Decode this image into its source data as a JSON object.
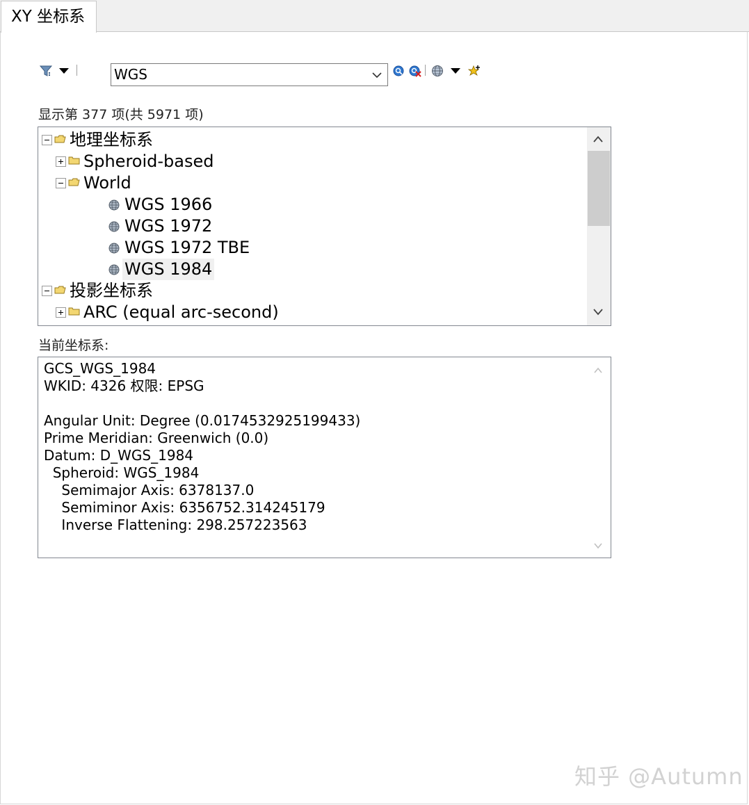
{
  "tab": {
    "label": "XY 坐标系"
  },
  "toolbar": {
    "filter_icon": "filter-icon",
    "search_value": "WGS",
    "icons": [
      "search-icon",
      "clear-search-icon",
      "globe-icon",
      "dropdown-arrow-icon",
      "add-favorite-icon"
    ]
  },
  "count_label": "显示第 377 项(共 5971 项)",
  "tree": {
    "rows": [
      {
        "label": "地理坐标系",
        "level": 0,
        "type": "folder",
        "expander": "minus"
      },
      {
        "label": "Spheroid-based",
        "level": 1,
        "type": "folder",
        "expander": "plus"
      },
      {
        "label": "World",
        "level": 1,
        "type": "folder",
        "expander": "minus"
      },
      {
        "label": "WGS 1966",
        "level": 2,
        "type": "globe"
      },
      {
        "label": "WGS 1972",
        "level": 2,
        "type": "globe"
      },
      {
        "label": "WGS 1972 TBE",
        "level": 2,
        "type": "globe"
      },
      {
        "label": "WGS 1984",
        "level": 2,
        "type": "globe",
        "selected": true
      },
      {
        "label": "投影坐标系",
        "level": 0,
        "type": "folder",
        "expander": "minus"
      },
      {
        "label": "ARC (equal arc-second)",
        "level": 1,
        "type": "folder",
        "expander": "plus"
      }
    ]
  },
  "current_label": "当前坐标系:",
  "current_info": [
    "GCS_WGS_1984",
    "WKID: 4326 权限: EPSG",
    "",
    "Angular Unit: Degree (0.0174532925199433)",
    "Prime Meridian: Greenwich (0.0)",
    "Datum: D_WGS_1984",
    "  Spheroid: WGS_1984",
    "    Semimajor Axis: 6378137.0",
    "    Semiminor Axis: 6356752.314245179",
    "    Inverse Flattening: 298.257223563"
  ],
  "watermark": "知乎 @Autumn",
  "colors": {
    "selected_bg": "#f0f0f0",
    "border": "#828790",
    "scroll_thumb": "#cdcdcd"
  }
}
